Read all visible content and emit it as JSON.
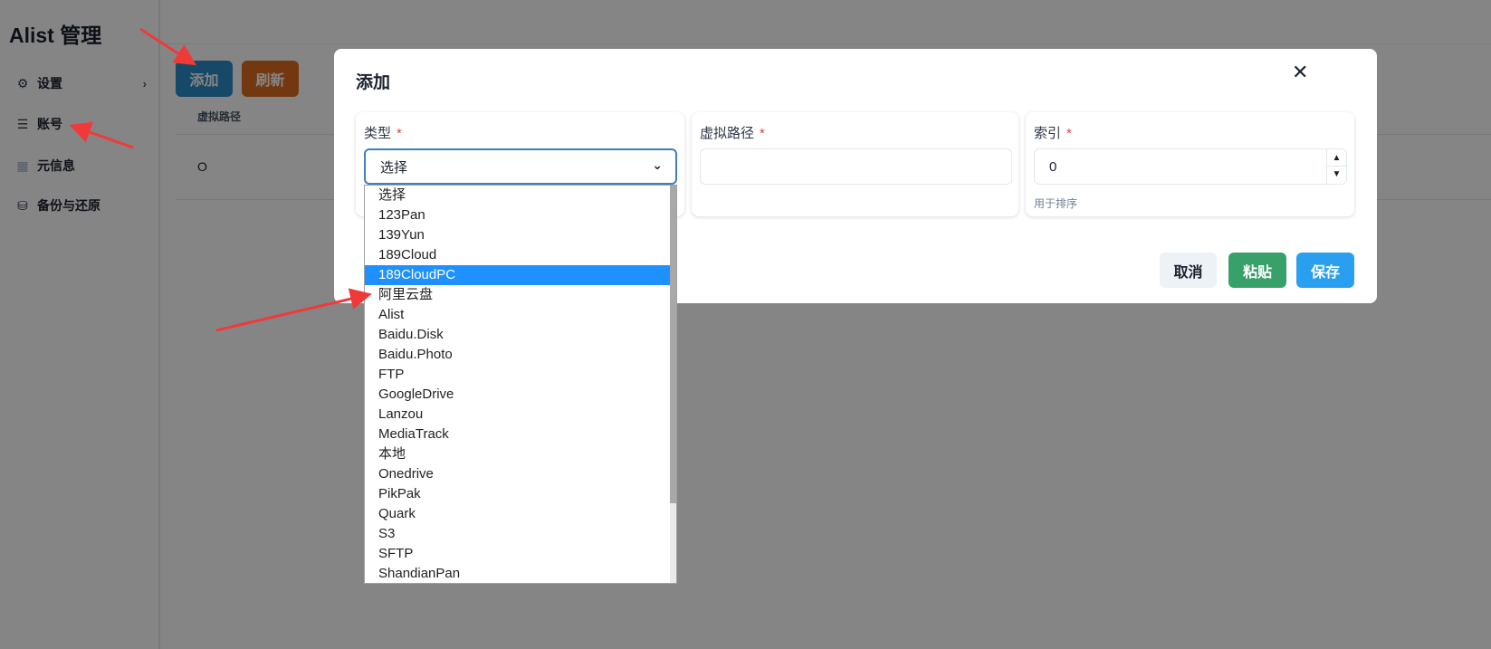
{
  "sidebar": {
    "brand": "Alist 管理",
    "items": [
      {
        "label": "设置",
        "icon": "gear-icon"
      },
      {
        "label": "账号",
        "icon": "list-icon"
      },
      {
        "label": "元信息",
        "icon": "grid-icon"
      },
      {
        "label": "备份与还原",
        "icon": "database-icon"
      }
    ]
  },
  "toolbar": {
    "add": "添加",
    "refresh": "刷新"
  },
  "table": {
    "headers": [
      "虚拟路径"
    ],
    "rows": [
      [
        "O"
      ]
    ]
  },
  "modal": {
    "title": "添加",
    "fields": {
      "type": {
        "label": "类型",
        "required": "*",
        "value": "选择"
      },
      "path": {
        "label": "虚拟路径",
        "required": "*",
        "value": ""
      },
      "index": {
        "label": "索引",
        "required": "*",
        "value": "0",
        "help": "用于排序"
      }
    },
    "buttons": {
      "cancel": "取消",
      "paste": "粘贴",
      "save": "保存"
    }
  },
  "dropdown": {
    "highlighted": "189CloudPC",
    "scroll_fraction": 0.8,
    "options": [
      "选择",
      "123Pan",
      "139Yun",
      "189Cloud",
      "189CloudPC",
      "阿里云盘",
      "Alist",
      "Baidu.Disk",
      "Baidu.Photo",
      "FTP",
      "GoogleDrive",
      "Lanzou",
      "MediaTrack",
      "本地",
      "Onedrive",
      "PikPak",
      "Quark",
      "S3",
      "SFTP",
      "ShandianPan"
    ]
  },
  "colors": {
    "add": "#2b8ac6",
    "refresh": "#dd6b20",
    "cancel": "#edf2f7",
    "paste": "#38a169",
    "save": "#2a9ff0",
    "highlight": "#1e90ff",
    "annotation": "#f03a3a"
  }
}
